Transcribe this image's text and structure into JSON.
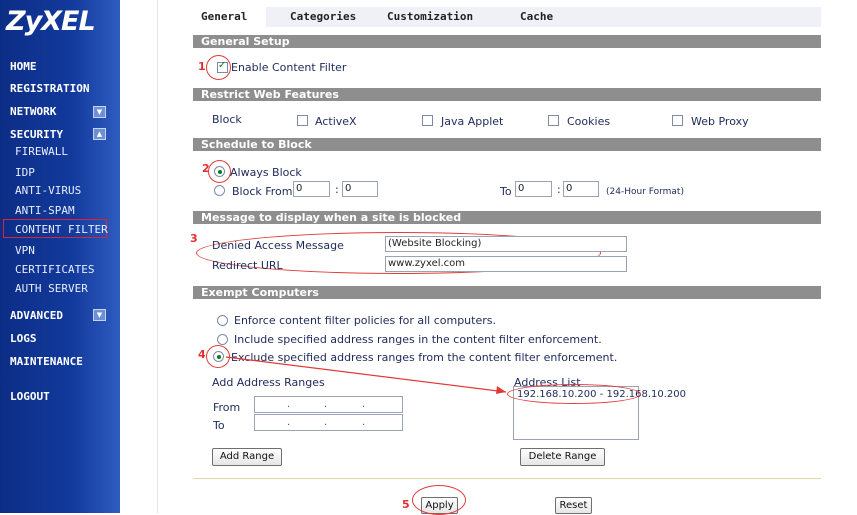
{
  "brand": {
    "logo": "ZyXEL"
  },
  "sidebar": {
    "items": [
      {
        "label": "HOME"
      },
      {
        "label": "REGISTRATION"
      },
      {
        "label": "NETWORK"
      },
      {
        "label": "SECURITY"
      },
      {
        "label": "FIREWALL"
      },
      {
        "label": "IDP"
      },
      {
        "label": "ANTI-VIRUS"
      },
      {
        "label": "ANTI-SPAM"
      },
      {
        "label": "CONTENT FILTER"
      },
      {
        "label": "VPN"
      },
      {
        "label": "CERTIFICATES"
      },
      {
        "label": "AUTH SERVER"
      },
      {
        "label": "ADVANCED"
      },
      {
        "label": "LOGS"
      },
      {
        "label": "MAINTENANCE"
      },
      {
        "label": "LOGOUT"
      }
    ],
    "selected": "CONTENT FILTER"
  },
  "tabs": [
    {
      "label": "General",
      "active": true
    },
    {
      "label": "Categories"
    },
    {
      "label": "Customization"
    },
    {
      "label": "Cache"
    }
  ],
  "general_setup": {
    "title": "General Setup",
    "enable_label": "Enable Content Filter",
    "enable_checked": true
  },
  "restrict": {
    "title": "Restrict Web Features",
    "block_label": "Block",
    "options": [
      {
        "label": "ActiveX",
        "checked": false
      },
      {
        "label": "Java Applet",
        "checked": false
      },
      {
        "label": "Cookies",
        "checked": false
      },
      {
        "label": "Web Proxy",
        "checked": false
      }
    ]
  },
  "schedule": {
    "title": "Schedule to Block",
    "always_label": "Always Block",
    "from_label": "Block From",
    "from_hour": "0",
    "from_min": "0",
    "to_label": "To",
    "to_hour": "0",
    "to_min": "0",
    "colon": ":",
    "format_note": "(24-Hour Format)",
    "selected": "always"
  },
  "message": {
    "title": "Message to display when a site is blocked",
    "denied_label": "Denied Access Message",
    "denied_value": "(Website Blocking)",
    "redirect_label": "Redirect URL",
    "redirect_value": "www.zyxel.com"
  },
  "exempt": {
    "title": "Exempt Computers",
    "options": [
      {
        "label": "Enforce content filter policies for all computers."
      },
      {
        "label": "Include specified address ranges in the content filter enforcement."
      },
      {
        "label": "Exclude specified address ranges from the content filter enforcement."
      }
    ],
    "selected_index": 2,
    "add_ranges_label": "Add Address Ranges",
    "from_label": "From",
    "to_label": "To",
    "address_list_label": "Address List",
    "address_list": [
      "192.168.10.200 - 192.168.10.200"
    ],
    "add_range_button": "Add Range",
    "delete_range_button": "Delete Range"
  },
  "actions": {
    "apply": "Apply",
    "reset": "Reset"
  },
  "annotations": [
    "1",
    "2",
    "3",
    "4",
    "5"
  ],
  "colors": {
    "sidebar": "#123a9c",
    "section_bar": "#8e8e8e",
    "highlight": "#e23a3a"
  }
}
